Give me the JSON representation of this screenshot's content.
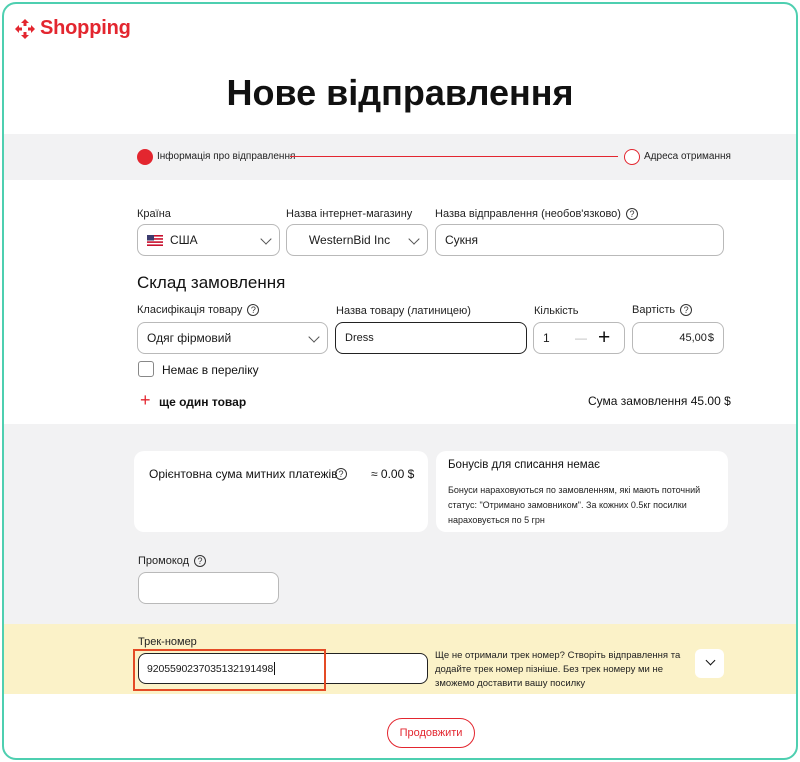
{
  "header": {
    "logo_text": "Shopping",
    "page_title": "Нове відправлення"
  },
  "steps": [
    {
      "label": "Інформація про відправлення",
      "state": "active"
    },
    {
      "label": "Адреса отримання",
      "state": "inactive"
    }
  ],
  "shipment": {
    "country_label": "Країна",
    "country_value": "США",
    "store_label": "Назва інтернет-магазину",
    "store_value": "WesternBid Inc",
    "name_label": "Назва відправлення (необов'язково)",
    "name_value": "Сукня"
  },
  "order": {
    "title": "Склад замовлення",
    "class_label": "Класифікація товару",
    "class_value": "Одяг фірмовий",
    "product_label": "Назва товару (латиницею)",
    "product_value": "Dress",
    "qty_label": "Кількість",
    "qty_value": "1",
    "qty_minus": "—",
    "qty_plus": "+",
    "cost_label": "Вартість",
    "cost_value": "45,00",
    "currency": "$",
    "not_in_list": "Немає в переліку",
    "add_plus": "+",
    "add_item": "ще один товар",
    "sum": "Сума замовлення 45.00 $"
  },
  "customs": {
    "label": "Орієнтовна сума митних платежів",
    "value": "≈ 0.00 $"
  },
  "bonus": {
    "title": "Бонусів для списання немає",
    "text": "Бонуси нараховуються по замовленням, які мають поточний статус: \"Отримано замовником\". За кожних 0.5кг посилки нараховується по 5 грн"
  },
  "promo": {
    "label": "Промокод",
    "value": ""
  },
  "tracking": {
    "label": "Трек-номер",
    "value": "9205590237035132191498",
    "hint": "Ще не отримали трек номер? Створіть відправлення та додайте трек номер пізніше. Без трек номеру ми не зможемо доставити вашу посилку"
  },
  "actions": {
    "continue": "Продовжити"
  },
  "icons": {
    "logo": "shopping-logo-icon",
    "flag": "us-flag-icon",
    "help": "question-circle-icon",
    "chevron": "chevron-down-icon"
  },
  "colors": {
    "accent": "#e3262f",
    "frame": "#4ecfb0",
    "band_grey": "#f2f2f3",
    "band_yellow": "#fbf2c8",
    "highlight": "#e44b25"
  }
}
